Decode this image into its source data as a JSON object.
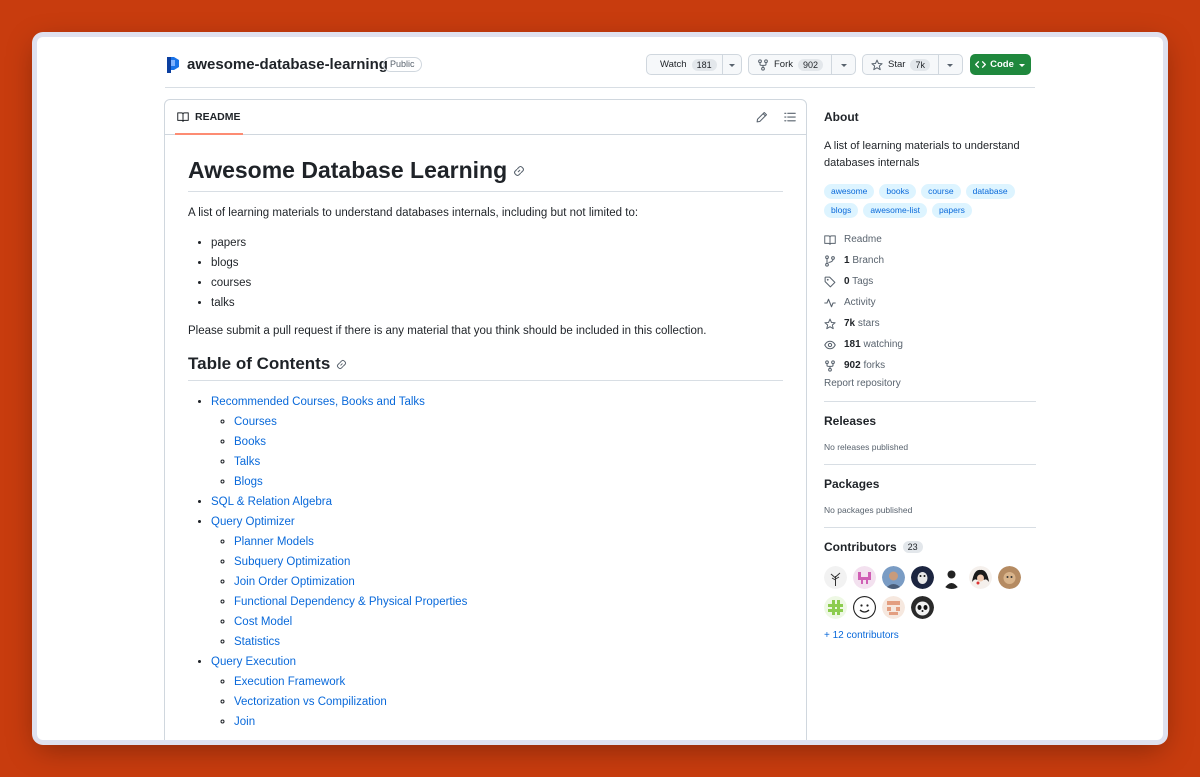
{
  "header": {
    "repo_name": "awesome-database-learning",
    "visibility": "Public",
    "watch_label": "Watch",
    "watch_count": "181",
    "fork_label": "Fork",
    "fork_count": "902",
    "star_label": "Star",
    "star_count": "7k",
    "code_label": "Code"
  },
  "readme": {
    "tab_label": "README",
    "title": "Awesome Database Learning",
    "intro": "A list of learning materials to understand databases internals, including but not limited to:",
    "items": [
      "papers",
      "blogs",
      "courses",
      "talks"
    ],
    "submit_note": "Please submit a pull request if there is any material that you think should be included in this collection.",
    "toc_title": "Table of Contents",
    "toc": [
      {
        "label": "Recommended Courses, Books and Talks",
        "children": [
          "Courses",
          "Books",
          "Talks",
          "Blogs"
        ]
      },
      {
        "label": "SQL & Relation Algebra",
        "children": []
      },
      {
        "label": "Query Optimizer",
        "children": [
          "Planner Models",
          "Subquery Optimization",
          "Join Order Optimization",
          "Functional Dependency & Physical Properties",
          "Cost Model",
          "Statistics"
        ]
      },
      {
        "label": "Query Execution",
        "children": [
          "Execution Framework",
          "Vectorization vs Compilization",
          "Join"
        ]
      }
    ]
  },
  "sidebar": {
    "about_title": "About",
    "about_desc": "A list of learning materials to understand databases internals",
    "topics": [
      "awesome",
      "books",
      "course",
      "database",
      "blogs",
      "awesome-list",
      "papers"
    ],
    "stats": [
      {
        "icon": "book-icon",
        "bold": "",
        "text": "Readme"
      },
      {
        "icon": "branch-icon",
        "bold": "1",
        "text": "Branch"
      },
      {
        "icon": "tag-icon",
        "bold": "0",
        "text": "Tags"
      },
      {
        "icon": "pulse-icon",
        "bold": "",
        "text": "Activity"
      },
      {
        "icon": "star-icon",
        "bold": "7k",
        "text": "stars"
      },
      {
        "icon": "eye-icon",
        "bold": "181",
        "text": "watching"
      },
      {
        "icon": "fork-icon",
        "bold": "902",
        "text": "forks"
      }
    ],
    "report": "Report repository",
    "releases_title": "Releases",
    "releases_note": "No releases published",
    "packages_title": "Packages",
    "packages_note": "No packages published",
    "contributors_title": "Contributors",
    "contributors_count": "23",
    "more_contributors": "+ 12 contributors"
  },
  "colors": {
    "background": "#c83c0e",
    "link": "#0969da",
    "code_button": "#1f883d",
    "topic_bg": "#ddf4ff"
  }
}
